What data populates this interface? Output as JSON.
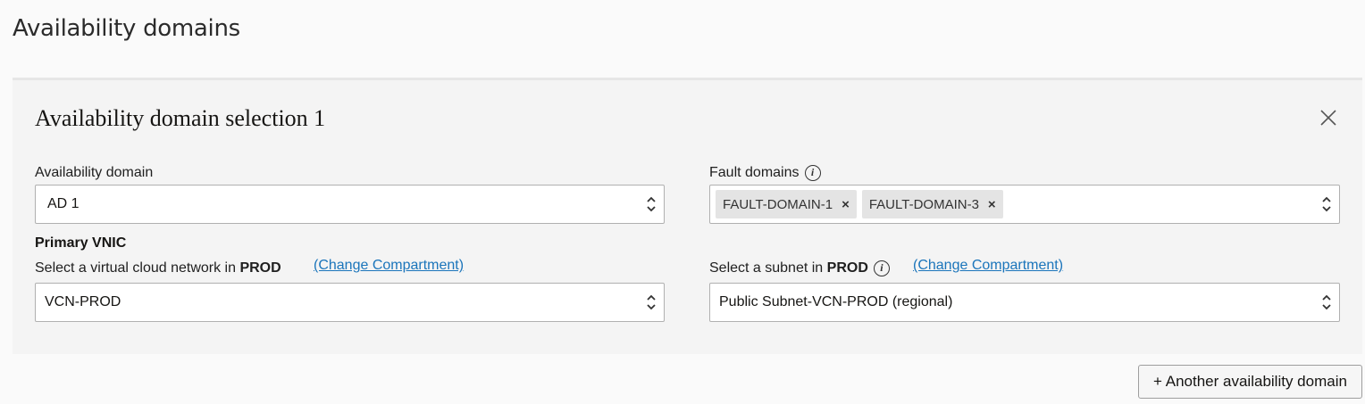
{
  "page": {
    "title": "Availability domains"
  },
  "panel": {
    "title": "Availability domain selection 1",
    "availability_domain": {
      "label": "Availability domain",
      "value": "AD 1"
    },
    "fault_domains": {
      "label": "Fault domains",
      "chips": [
        "FAULT-DOMAIN-1",
        "FAULT-DOMAIN-3"
      ]
    },
    "primary_vnic": {
      "label": "Primary VNIC"
    },
    "vcn": {
      "label_prefix": "Select a virtual cloud network in",
      "compartment": "PROD",
      "change_link": "(Change Compartment)",
      "value": "VCN-PROD"
    },
    "subnet": {
      "label_prefix": "Select a subnet in",
      "compartment": "PROD",
      "change_link": "(Change Compartment)",
      "value": "Public Subnet-VCN-PROD (regional)"
    }
  },
  "add_button": {
    "label": "+ Another availability domain"
  },
  "icons": {
    "close": "close-icon",
    "info": "info-icon",
    "chevron": "chevron-updown-icon",
    "chip_remove": "remove-chip-icon"
  }
}
